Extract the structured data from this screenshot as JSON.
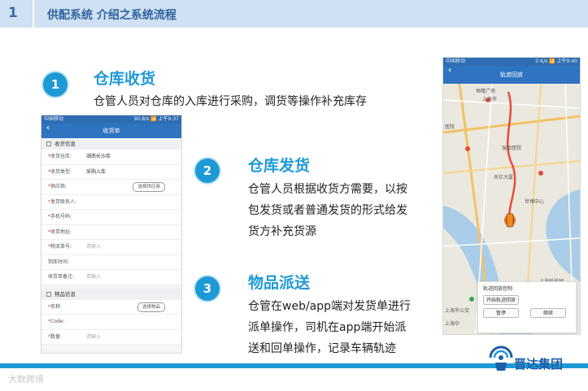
{
  "header": {
    "number": "1",
    "title": "供配系统 介绍之系统流程"
  },
  "sections": [
    {
      "num": "1",
      "title": "仓库收货",
      "body": [
        "仓管人员对仓库的入库进行采购，调货等操作补充库存"
      ]
    },
    {
      "num": "2",
      "title": "仓库发货",
      "body": [
        "仓管人员根据收货方需要，以按",
        "包发货或者普通发货的形式给发",
        "货方补充货源"
      ]
    },
    {
      "num": "3",
      "title": "物品派送",
      "body": [
        "仓管在web/app端对发货单进行",
        "派单操作，司机在app端开始派",
        "送和回单操作，记录车辆轨迹"
      ]
    }
  ],
  "phone_receipt": {
    "status_left": "中国移动",
    "status_right": "90.8/s 📶 上午9:37",
    "nav_title": "收货单",
    "section1": "收货信息",
    "rows": [
      {
        "label": "收货仓库:",
        "req": true,
        "value": "湖南长沙库"
      },
      {
        "label": "收货类型:",
        "req": true,
        "value": "采购入库"
      },
      {
        "label": "供应商:",
        "req": true,
        "button": "选择供应商"
      },
      {
        "label": "发货联系人:",
        "req": true
      },
      {
        "label": "手机号码:",
        "req": true
      },
      {
        "label": "收货地址:",
        "req": true
      },
      {
        "label": "物流单号:",
        "req": true,
        "placeholder": "请输入"
      },
      {
        "label": "到库时间:",
        "req": false
      },
      {
        "label": "收货单备注:",
        "req": false,
        "placeholder": "请输入"
      }
    ],
    "section2": "物品信息",
    "rows2": [
      {
        "label": "名称:",
        "req": true,
        "button": "选择物品"
      },
      {
        "label": "Code:",
        "req": true
      },
      {
        "label": "数量:",
        "req": true,
        "placeholder": "请输入"
      }
    ]
  },
  "phone_track": {
    "status_left": "中国移动",
    "status_right": "0 K/s 📶 上午9:40",
    "nav_title": "轨迹回放",
    "map_labels": [
      "恒隆广场",
      "上海市",
      "医院",
      "瑞金医院",
      "天亿大厦",
      "世博中心",
      "上海市公交",
      "上海科技园",
      "上海中"
    ],
    "control_title": "轨迹回放控制",
    "start_btn": "开始轨迹回放",
    "pause_btn": "暂停",
    "resume_btn": "继续"
  },
  "logo_text": "晋达集团",
  "watermark": "大数跨境",
  "colors": {
    "accent": "#1d9ad6",
    "header_bg": "#cfe1f2",
    "header_text": "#2f62a2"
  }
}
